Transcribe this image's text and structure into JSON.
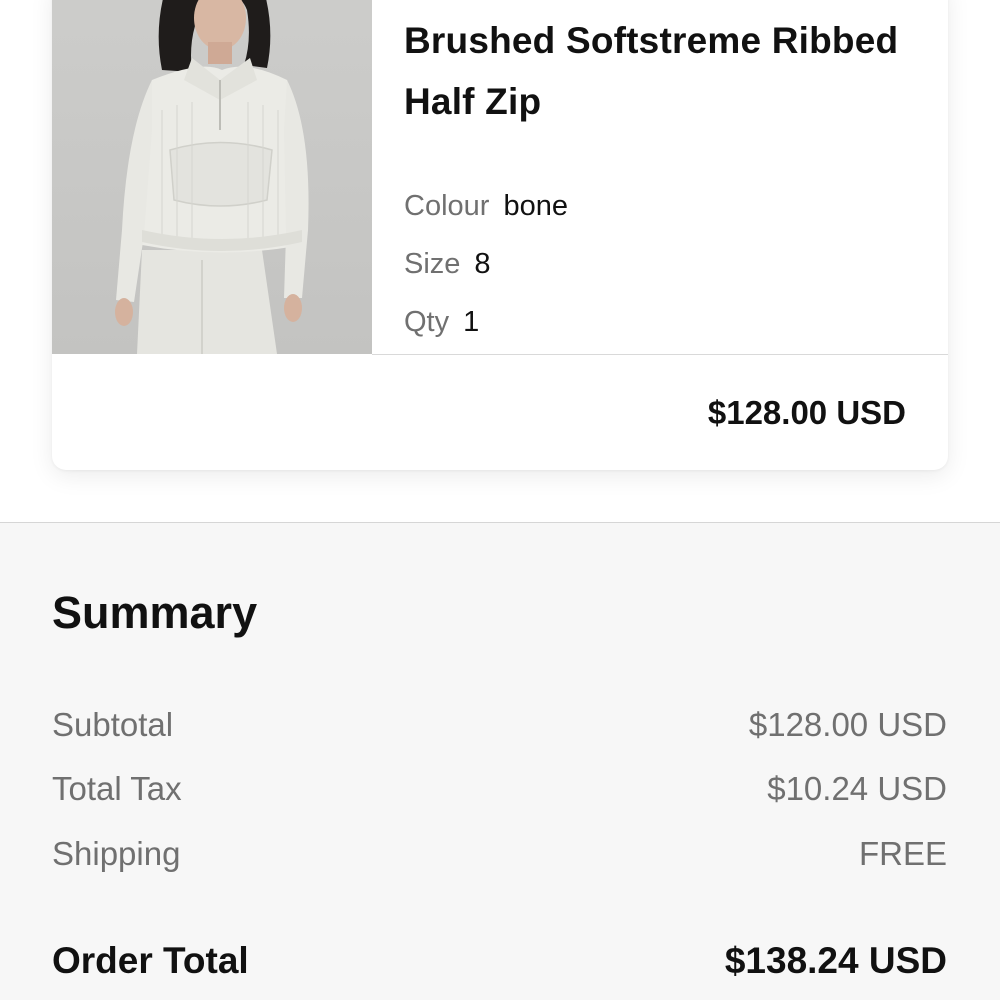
{
  "product": {
    "title_line1": "Brushed Softstreme Ribbed",
    "title_line2": "Half Zip",
    "image_icon": "product-photo-icon",
    "attributes": [
      {
        "label": "Colour",
        "value": "bone"
      },
      {
        "label": "Size",
        "value": "8"
      },
      {
        "label": "Qty",
        "value": "1"
      }
    ],
    "price": "$128.00 USD"
  },
  "summary": {
    "title": "Summary",
    "rows": [
      {
        "label": "Subtotal",
        "value": "$128.00 USD"
      },
      {
        "label": "Total Tax",
        "value": "$10.24 USD"
      },
      {
        "label": "Shipping",
        "value": "FREE"
      }
    ],
    "total": {
      "label": "Order Total",
      "value": "$138.24 USD"
    }
  },
  "colors": {
    "background": "#ffffff",
    "summary_background": "#f7f7f7",
    "text_primary": "#111111",
    "text_secondary": "#707070",
    "divider": "#d9d9d9"
  }
}
